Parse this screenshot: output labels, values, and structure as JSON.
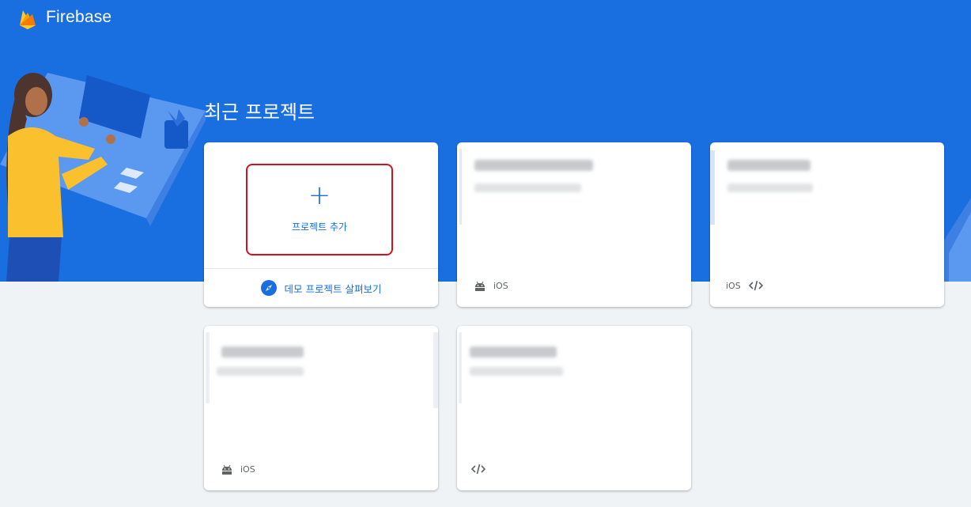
{
  "app": {
    "name": "Firebase"
  },
  "section": {
    "title": "최근 프로젝트"
  },
  "add_project": {
    "label": "프로젝트 추가",
    "plus": "+"
  },
  "demo": {
    "label": "데모 프로젝트 살펴보기"
  },
  "projects": [
    {
      "name": "",
      "id": "",
      "platforms": [
        "android-icon",
        "iOS"
      ]
    },
    {
      "name": "",
      "id": "",
      "platforms": [
        "iOS",
        "code-icon"
      ]
    },
    {
      "name": "",
      "id": "",
      "platforms": [
        "android-icon",
        "iOS"
      ]
    },
    {
      "name": "",
      "id": "",
      "platforms": [
        "code-icon"
      ]
    }
  ],
  "platform_labels": {
    "ios": "iOS"
  },
  "colors": {
    "brand_blue": "#1a6fe0",
    "highlight_red": "#d3111e",
    "page_bg": "#f0f3f6"
  }
}
